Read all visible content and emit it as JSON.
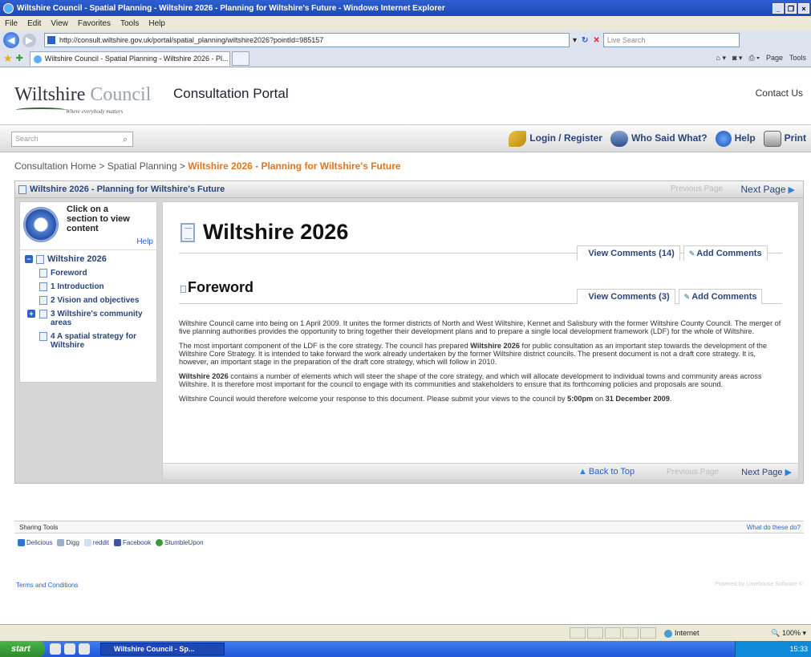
{
  "browser": {
    "window_title": "Wiltshire Council - Spatial Planning - Wiltshire 2026 - Planning for Wiltshire's Future - Windows Internet Explorer",
    "menu": [
      "File",
      "Edit",
      "View",
      "Favorites",
      "Tools",
      "Help"
    ],
    "url": "http://consult.wiltshire.gov.uk/portal/spatial_planning/wiltshire2026?pointId=985157",
    "search_placeholder": "Live Search",
    "tab_title": "Wiltshire Council - Spatial Planning - Wiltshire 2026 - Pl...",
    "cmd": [
      "Page",
      "Tools"
    ]
  },
  "site": {
    "logo_wilt": "Wiltshire",
    "logo_council": "Council",
    "logo_tagline": "Where everybody matters",
    "portal_title": "Consultation Portal",
    "contact": "Contact Us",
    "search_placeholder": "Search",
    "tools": {
      "login": "Login / Register",
      "who": "Who Said What?",
      "help": "Help",
      "print": "Print"
    }
  },
  "breadcrumb": {
    "home": "Consultation Home",
    "sep": ">",
    "section": "Spatial Planning",
    "current": "Wiltshire 2026 - Planning for Wiltshire's Future"
  },
  "panel": {
    "title": "Wiltshire 2026 - Planning for Wiltshire's Future",
    "previous": "Previous Page",
    "next": "Next Page"
  },
  "nav": {
    "heading": "Click on a section to view content",
    "help": "Help",
    "root": "Wiltshire 2026",
    "items": [
      "Foreword",
      "1 Introduction",
      "2 Vision and objectives",
      "3 Wiltshire's community areas",
      "4 A spatial strategy for Wiltshire"
    ]
  },
  "content": {
    "title": "Wiltshire 2026",
    "title_view_comments": "View Comments (14)",
    "title_add_comments": "Add Comments",
    "section": "Foreword",
    "section_view_comments": "View Comments (3)",
    "section_add_comments": "Add Comments",
    "p1": "Wiltshire Council came into being on 1 April 2009. It unites the former districts of North and West Wiltshire, Kennet and Salisbury with the former Wiltshire County Council. The merger of five planning authorities provides the opportunity to bring together their development plans and to prepare a single local development framework (LDF) for the whole of Wiltshire.",
    "p2a": "The most important component of the LDF is the core strategy. The council has prepared ",
    "p2b": "Wiltshire 2026",
    "p2c": " for public consultation as an important step towards the development of the Wiltshire Core Strategy. It is intended to take forward the work already undertaken by the former Wiltshire district councils. The present document is not a draft core strategy. It is, however, an important stage in the preparation of the draft core strategy, which will follow in 2010.",
    "p3a": "Wiltshire 2026",
    "p3b": " contains a number of elements which will steer the shape of the core strategy, and which will allocate development to individual towns and community areas across Wiltshire. It is therefore most important for the council to engage with its communities and stakeholders to ensure that its forthcoming policies and proposals are sound.",
    "p4a": "Wiltshire Council would therefore welcome your response to this document. Please submit your views to the council by ",
    "p4b": "5:00pm",
    "p4c": " on ",
    "p4d": "31 December 2009",
    "p4e": "."
  },
  "bottom": {
    "back_to_top": "Back to Top",
    "previous": "Previous Page",
    "next": "Next Page"
  },
  "sharing": {
    "label": "Sharing Tools",
    "what": "What do these do?",
    "links": [
      "Delicious",
      "Digg",
      "reddit",
      "Facebook",
      "StumbleUpon"
    ]
  },
  "footer": {
    "terms": "Terms and Conditions",
    "powered": "Powered by Limehouse Software ©"
  },
  "status": {
    "zone": "Internet",
    "zoom": "100%"
  },
  "taskbar": {
    "start": "start",
    "task": "Wiltshire Council - Sp...",
    "time": "15:33"
  }
}
